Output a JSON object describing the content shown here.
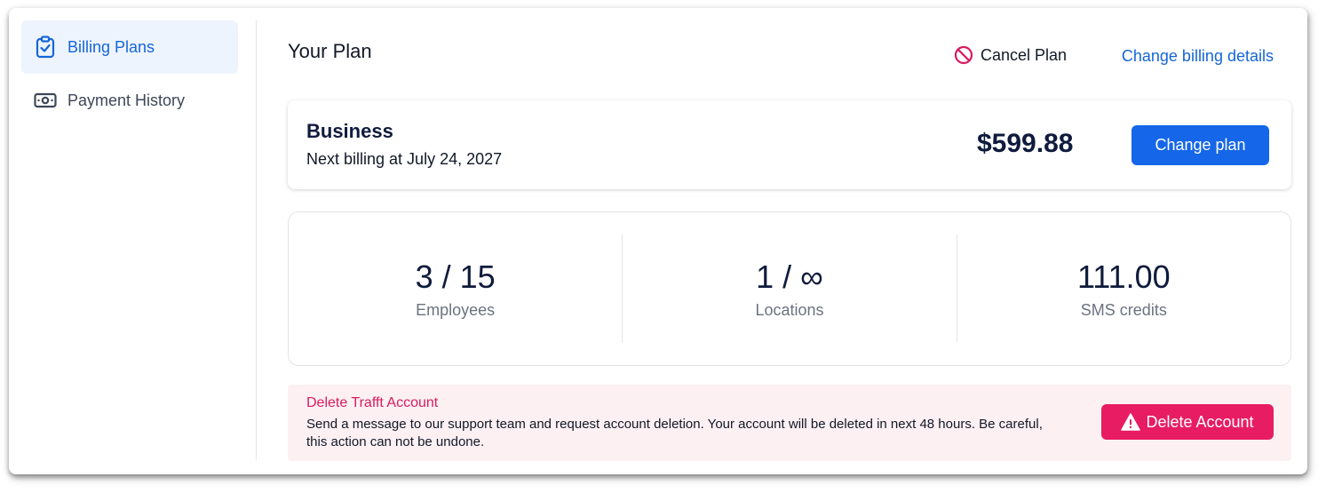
{
  "sidebar": {
    "items": [
      {
        "label": "Billing Plans",
        "icon": "clipboard-check-icon",
        "active": true
      },
      {
        "label": "Payment History",
        "icon": "cash-icon",
        "active": false
      }
    ]
  },
  "header": {
    "title": "Your Plan",
    "cancel_label": "Cancel Plan",
    "change_billing_label": "Change billing details"
  },
  "plan": {
    "name": "Business",
    "next_billing": "Next billing at July 24, 2027",
    "price": "$599.88",
    "change_label": "Change plan"
  },
  "stats": [
    {
      "value": "3 / 15",
      "label": "Employees"
    },
    {
      "value": "1 / ∞",
      "label": "Locations"
    },
    {
      "value": "111.00",
      "label": "SMS credits"
    }
  ],
  "delete": {
    "title": "Delete Trafft Account",
    "text": "Send a message to our support team and request account deletion. Your account will be deleted in next 48 hours. Be careful, this action can not be undone.",
    "button_label": "Delete Account"
  },
  "colors": {
    "accent": "#1566e8",
    "danger": "#e81c62",
    "danger_bg": "#fdf0f3"
  }
}
